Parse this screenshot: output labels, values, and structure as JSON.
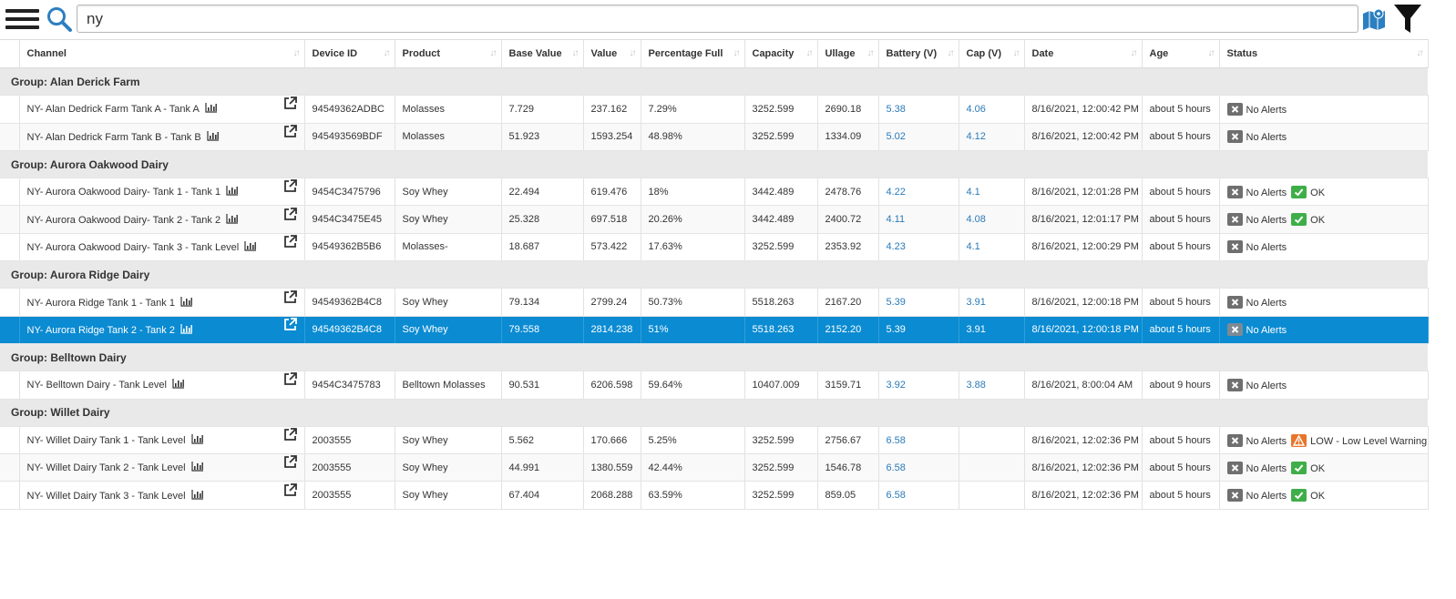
{
  "search": {
    "value": "ny"
  },
  "columns": {
    "channel": "Channel",
    "device_id": "Device ID",
    "product": "Product",
    "base_value": "Base Value",
    "value": "Value",
    "percentage_full": "Percentage Full",
    "capacity": "Capacity",
    "ullage": "Ullage",
    "battery": "Battery (V)",
    "cap": "Cap (V)",
    "date": "Date",
    "age": "Age",
    "status": "Status"
  },
  "groups": [
    {
      "label": "Group: Alan Derick Farm",
      "rows": [
        {
          "channel": "NY- Alan Dedrick Farm Tank A - Tank A",
          "device_id": "94549362ADBC",
          "product": "Molasses",
          "base_value": "7.729",
          "value": "237.162",
          "percentage_full": "7.29%",
          "capacity": "3252.599",
          "ullage": "2690.18",
          "battery": "5.38",
          "cap": "4.06",
          "date": "8/16/2021, 12:00:42 PM",
          "age": "about 5 hours",
          "alert": "No Alerts",
          "extra": "",
          "extra_type": ""
        },
        {
          "channel": "NY- Alan Dedrick Farm Tank B - Tank B",
          "device_id": "945493569BDF",
          "product": "Molasses",
          "base_value": "51.923",
          "value": "1593.254",
          "percentage_full": "48.98%",
          "capacity": "3252.599",
          "ullage": "1334.09",
          "battery": "5.02",
          "cap": "4.12",
          "date": "8/16/2021, 12:00:42 PM",
          "age": "about 5 hours",
          "alert": "No Alerts",
          "extra": "",
          "extra_type": ""
        }
      ]
    },
    {
      "label": "Group: Aurora Oakwood Dairy",
      "rows": [
        {
          "channel": "NY- Aurora Oakwood Dairy- Tank 1 - Tank 1",
          "device_id": "9454C3475796",
          "product": "Soy Whey",
          "base_value": "22.494",
          "value": "619.476",
          "percentage_full": "18%",
          "capacity": "3442.489",
          "ullage": "2478.76",
          "battery": "4.22",
          "cap": "4.1",
          "date": "8/16/2021, 12:01:28 PM",
          "age": "about 5 hours",
          "alert": "No Alerts",
          "extra": "OK",
          "extra_type": "ok"
        },
        {
          "channel": "NY- Aurora Oakwood Dairy- Tank 2 - Tank 2",
          "device_id": "9454C3475E45",
          "product": "Soy Whey",
          "base_value": "25.328",
          "value": "697.518",
          "percentage_full": "20.26%",
          "capacity": "3442.489",
          "ullage": "2400.72",
          "battery": "4.11",
          "cap": "4.08",
          "date": "8/16/2021, 12:01:17 PM",
          "age": "about 5 hours",
          "alert": "No Alerts",
          "extra": "OK",
          "extra_type": "ok"
        },
        {
          "channel": "NY- Aurora Oakwood Dairy- Tank 3 - Tank Level",
          "device_id": "94549362B5B6",
          "product": "Molasses-",
          "base_value": "18.687",
          "value": "573.422",
          "percentage_full": "17.63%",
          "capacity": "3252.599",
          "ullage": "2353.92",
          "battery": "4.23",
          "cap": "4.1",
          "date": "8/16/2021, 12:00:29 PM",
          "age": "about 5 hours",
          "alert": "No Alerts",
          "extra": "",
          "extra_type": ""
        }
      ]
    },
    {
      "label": "Group: Aurora Ridge Dairy",
      "rows": [
        {
          "channel": "NY- Aurora Ridge Tank 1 - Tank 1",
          "device_id": "94549362B4C8",
          "product": "Soy Whey",
          "base_value": "79.134",
          "value": "2799.24",
          "percentage_full": "50.73%",
          "capacity": "5518.263",
          "ullage": "2167.20",
          "battery": "5.39",
          "cap": "3.91",
          "date": "8/16/2021, 12:00:18 PM",
          "age": "about 5 hours",
          "alert": "No Alerts",
          "extra": "",
          "extra_type": ""
        },
        {
          "channel": "NY- Aurora Ridge Tank 2 - Tank 2",
          "device_id": "94549362B4C8",
          "product": "Soy Whey",
          "base_value": "79.558",
          "value": "2814.238",
          "percentage_full": "51%",
          "capacity": "5518.263",
          "ullage": "2152.20",
          "battery": "5.39",
          "cap": "3.91",
          "date": "8/16/2021, 12:00:18 PM",
          "age": "about 5 hours",
          "alert": "No Alerts",
          "extra": "",
          "extra_type": "",
          "selected": true
        }
      ]
    },
    {
      "label": "Group: Belltown Dairy",
      "rows": [
        {
          "channel": "NY- Belltown Dairy - Tank Level",
          "device_id": "9454C3475783",
          "product": "Belltown Molasses",
          "base_value": "90.531",
          "value": "6206.598",
          "percentage_full": "59.64%",
          "capacity": "10407.009",
          "ullage": "3159.71",
          "battery": "3.92",
          "cap": "3.88",
          "date": "8/16/2021, 8:00:04 AM",
          "age": "about 9 hours",
          "alert": "No Alerts",
          "extra": "",
          "extra_type": ""
        }
      ]
    },
    {
      "label": "Group: Willet Dairy",
      "rows": [
        {
          "channel": "NY- Willet Dairy Tank 1 - Tank Level",
          "device_id": "2003555",
          "product": "Soy Whey",
          "base_value": "5.562",
          "value": "170.666",
          "percentage_full": "5.25%",
          "capacity": "3252.599",
          "ullage": "2756.67",
          "battery": "6.58",
          "cap": "",
          "date": "8/16/2021, 12:02:36 PM",
          "age": "about 5 hours",
          "alert": "No Alerts",
          "extra": "LOW - Low Level Warning",
          "extra_type": "warn"
        },
        {
          "channel": "NY- Willet Dairy Tank 2 - Tank Level",
          "device_id": "2003555",
          "product": "Soy Whey",
          "base_value": "44.991",
          "value": "1380.559",
          "percentage_full": "42.44%",
          "capacity": "3252.599",
          "ullage": "1546.78",
          "battery": "6.58",
          "cap": "",
          "date": "8/16/2021, 12:02:36 PM",
          "age": "about 5 hours",
          "alert": "No Alerts",
          "extra": "OK",
          "extra_type": "ok"
        },
        {
          "channel": "NY- Willet Dairy Tank 3 - Tank Level",
          "device_id": "2003555",
          "product": "Soy Whey",
          "base_value": "67.404",
          "value": "2068.288",
          "percentage_full": "63.59%",
          "capacity": "3252.599",
          "ullage": "859.05",
          "battery": "6.58",
          "cap": "",
          "date": "8/16/2021, 12:02:36 PM",
          "age": "about 5 hours",
          "alert": "No Alerts",
          "extra": "OK",
          "extra_type": "ok"
        }
      ]
    }
  ],
  "colors": {
    "selected_row": "#0a8bd2",
    "link_blue": "#2a7ab8",
    "ok_badge": "#3fae49",
    "warn_badge": "#e8752a",
    "alert_badge": "#6f6f6f",
    "group_bg": "#e9e9e9"
  },
  "icons": {
    "menu": "hamburger-menu-icon",
    "search": "magnifier-icon",
    "map": "map-marker-icon",
    "filter": "funnel-filter-icon",
    "chart": "bar-chart-icon",
    "open": "external-link-icon",
    "sort": "sort-arrows-icon"
  }
}
